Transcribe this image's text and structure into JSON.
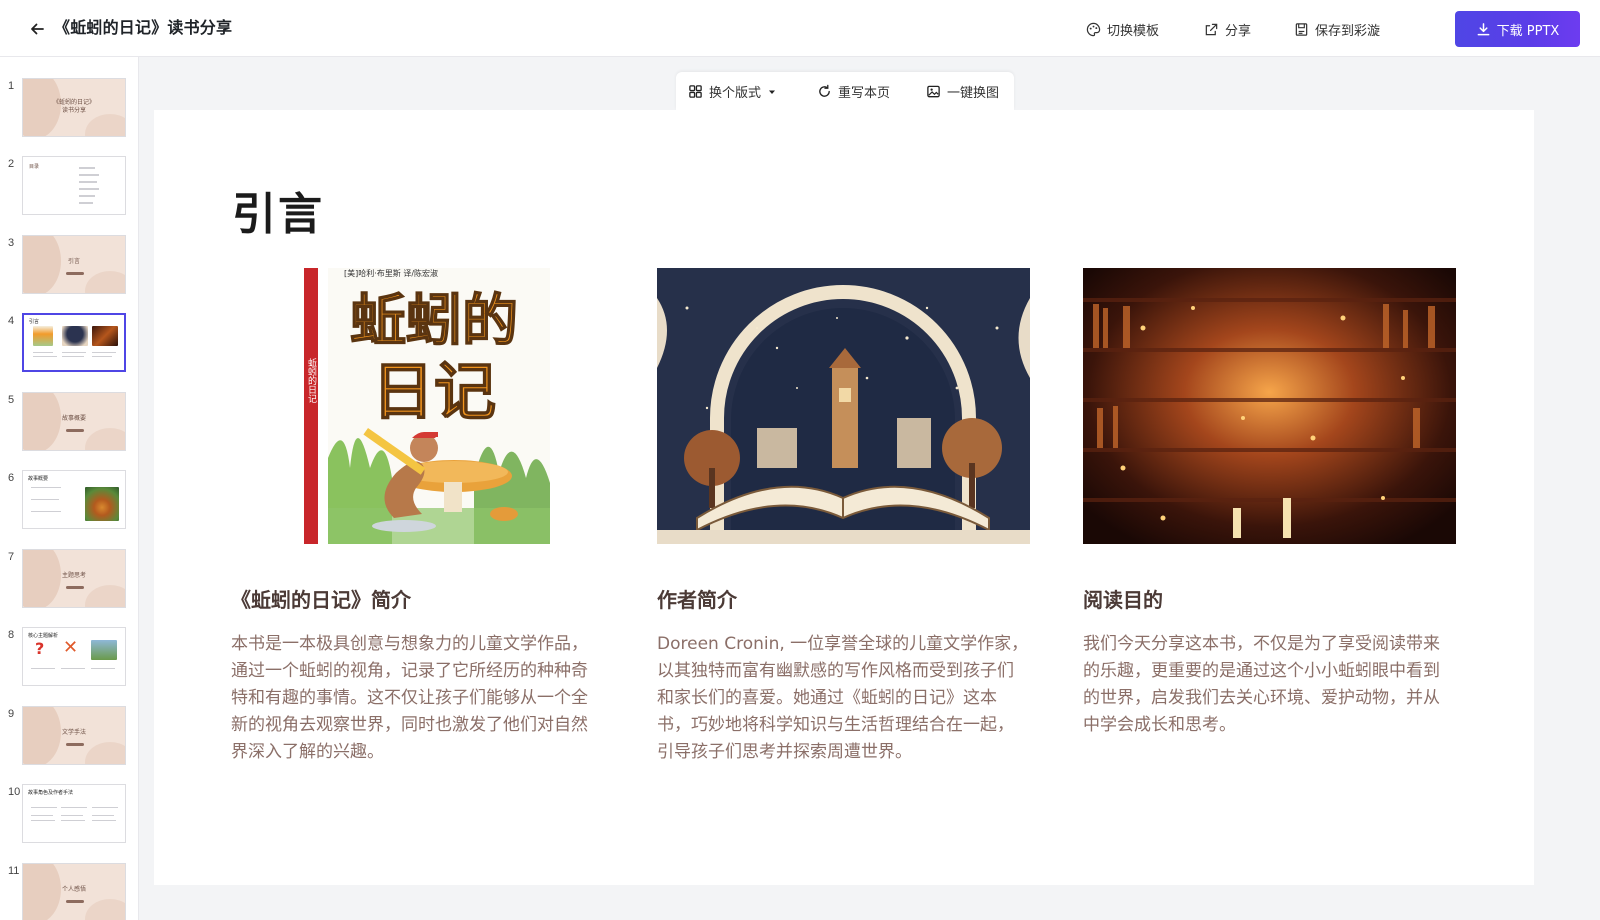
{
  "header": {
    "title": "《蚯蚓的日记》读书分享",
    "actions": {
      "switch_template": "切换模板",
      "share": "分享",
      "save": "保存到彩漩",
      "download": "下载 PPTX"
    }
  },
  "sidebar": {
    "slides": [
      {
        "num": "1",
        "style": "cover",
        "text": "《蚯蚓的日记》\n读书分享"
      },
      {
        "num": "2",
        "style": "toc",
        "text": "目录"
      },
      {
        "num": "3",
        "style": "section",
        "text": "引言"
      },
      {
        "num": "4",
        "style": "current",
        "text": "引言"
      },
      {
        "num": "5",
        "style": "section",
        "text": "故事概要"
      },
      {
        "num": "6",
        "style": "content",
        "text": "故事概要"
      },
      {
        "num": "7",
        "style": "section",
        "text": "主题思考"
      },
      {
        "num": "8",
        "style": "content",
        "text": "核心主题解析"
      },
      {
        "num": "9",
        "style": "section",
        "text": "文学手法"
      },
      {
        "num": "10",
        "style": "content",
        "text": "故事角色及作者手法"
      },
      {
        "num": "11",
        "style": "section",
        "text": "个人感悟"
      }
    ]
  },
  "slide_toolbar": {
    "change_layout": "换个版式",
    "rewrite": "重写本页",
    "replace_image": "一键换图"
  },
  "slide": {
    "title": "引言",
    "cards": [
      {
        "heading": "《蚯蚓的日记》简介",
        "body": "本书是一本极具创意与想象力的儿童文学作品，通过一个蚯蚓的视角，记录了它所经历的种种奇特和有趣的事情。这不仅让孩子们能够从一个全新的视角去观察世界，同时也激发了他们对自然界深入了解的兴趣。",
        "image": {
          "spine": "蚯蚓的日记",
          "title_line1": "蚯蚓的",
          "title_line2": "日记",
          "top_strip": "[美]哈利·布里斯  译/陈宏淑"
        }
      },
      {
        "heading": "作者简介",
        "body": "Doreen Cronin, 一位享誉全球的儿童文学作家，以其独特而富有幽默感的写作风格而受到孩子们和家长们的喜爱。她通过《蚯蚓的日记》这本书，巧妙地将科学知识与生活哲理结合在一起，引导孩子们思考并探索周遭世界。"
      },
      {
        "heading": "阅读目的",
        "body": "我们今天分享这本书，不仅是为了享受阅读带来的乐趣，更重要的是通过这个小小蚯蚓眼中看到的世界，启发我们去关心环境、爱护动物，并从中学会成长和思考。"
      }
    ]
  },
  "colors": {
    "accent": "#4f46e5",
    "heading": "#4b3a36",
    "body_text": "#8b6f68",
    "book_orange": "#f2951e"
  }
}
